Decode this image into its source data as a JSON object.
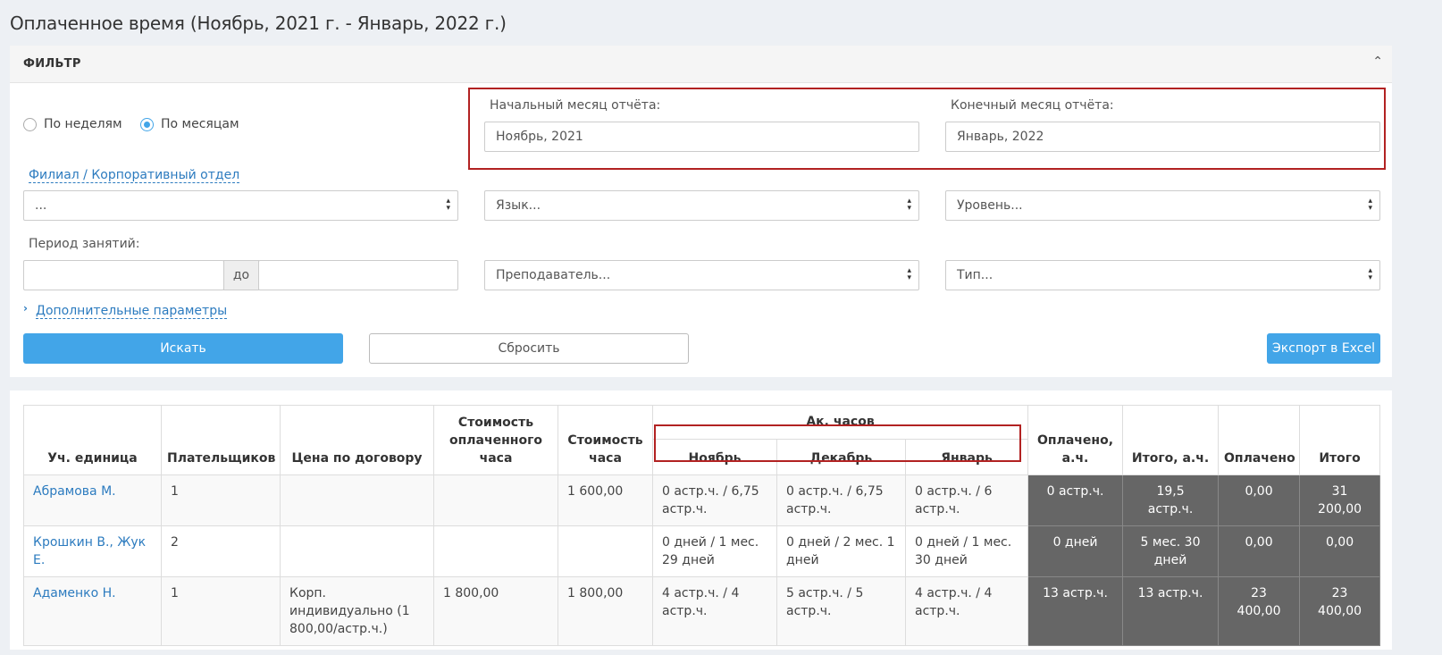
{
  "page": {
    "title": "Оплаченное время (Ноябрь, 2021 г. - Январь, 2022 г.)"
  },
  "filter": {
    "header": "ФИЛЬТР",
    "collapse_icon": "chevron-up-icon",
    "radio_weeks": "По неделям",
    "radio_months": "По месяцам",
    "selected_mode": "По месяцам",
    "start_month_label": "Начальный месяц отчёта:",
    "start_month_value": "Ноябрь, 2021",
    "end_month_label": "Конечный месяц отчёта:",
    "end_month_value": "Январь, 2022",
    "branch_link": "Филиал / Корпоративный отдел",
    "branch_select": "...",
    "language_select": "Язык...",
    "level_select": "Уровень...",
    "period_label": "Период занятий:",
    "period_to": "до",
    "period_from_value": "",
    "period_to_value": "",
    "teacher_select": "Преподаватель...",
    "type_select": "Тип...",
    "more_params": "Дополнительные параметры",
    "search_btn": "Искать",
    "reset_btn": "Сбросить",
    "export_btn": "Экспорт в Excel",
    "accent_color": "#42a5e8",
    "highlight_color": "#b22222"
  },
  "table": {
    "headers": {
      "unit": "Уч. единица",
      "payers": "Плательщиков",
      "contract_price": "Цена по договору",
      "paid_hour_cost": "Стоимость оплаченного часа",
      "hour_cost": "Стоимость часа",
      "ac_hours": "Ак. часов",
      "nov": "Ноябрь",
      "dec": "Декабрь",
      "jan": "Январь",
      "paid_ah": "Оплачено, а.ч.",
      "total_ah": "Итого, а.ч.",
      "paid": "Оплачено",
      "total": "Итого"
    },
    "rows": [
      {
        "unit": "Абрамова М.",
        "payers": "1",
        "contract_price": "",
        "paid_hour_cost": "",
        "hour_cost": "1 600,00",
        "nov": "0 астр.ч. / 6,75 астр.ч.",
        "dec": "0 астр.ч. / 6,75 астр.ч.",
        "jan": "0 астр.ч. / 6 астр.ч.",
        "paid_ah": "0 астр.ч.",
        "total_ah": "19,5 астр.ч.",
        "paid": "0,00",
        "total": "31 200,00"
      },
      {
        "unit": "Крошкин В., Жук Е.",
        "payers": "2",
        "contract_price": "",
        "paid_hour_cost": "",
        "hour_cost": "",
        "nov": "0 дней / 1 мес. 29 дней",
        "dec": "0 дней / 2 мес. 1 дней",
        "jan": "0 дней / 1 мес. 30 дней",
        "paid_ah": "0 дней",
        "total_ah": "5 мес. 30 дней",
        "paid": "0,00",
        "total": "0,00"
      },
      {
        "unit": "Адаменко Н.",
        "payers": "1",
        "contract_price": "Корп. индивидуально (1 800,00/астр.ч.)",
        "paid_hour_cost": "1 800,00",
        "hour_cost": "1 800,00",
        "nov": "4 астр.ч. / 4 астр.ч.",
        "dec": "5 астр.ч. / 5 астр.ч.",
        "jan": "4 астр.ч. / 4 астр.ч.",
        "paid_ah": "13 астр.ч.",
        "total_ah": "13 астр.ч.",
        "paid": "23 400,00",
        "total": "23 400,00"
      }
    ]
  }
}
